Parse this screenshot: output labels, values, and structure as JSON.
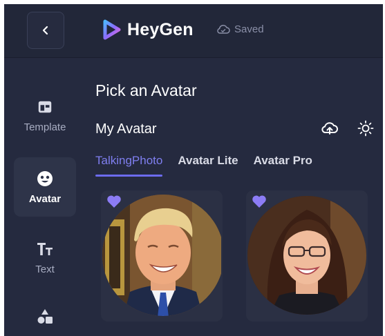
{
  "app": {
    "brand": "HeyGen",
    "save_status": "Saved"
  },
  "sidebar": {
    "items": [
      {
        "label": "Template",
        "icon": "template-icon"
      },
      {
        "label": "Avatar",
        "icon": "avatar-icon",
        "active": true
      },
      {
        "label": "Text",
        "icon": "text-icon"
      },
      {
        "label": "",
        "icon": "elements-icon"
      }
    ]
  },
  "panel": {
    "title": "Pick an Avatar",
    "section_title": "My Avatar",
    "tabs": [
      {
        "label": "TalkingPhoto",
        "active": true
      },
      {
        "label": "Avatar Lite"
      },
      {
        "label": "Avatar Pro"
      }
    ],
    "avatars": [
      {
        "favorite": true
      },
      {
        "favorite": true
      }
    ]
  },
  "colors": {
    "background": "#252a3f",
    "accent": "#6c6cf0",
    "text": "#ffffff",
    "muted": "#a8adc2"
  }
}
